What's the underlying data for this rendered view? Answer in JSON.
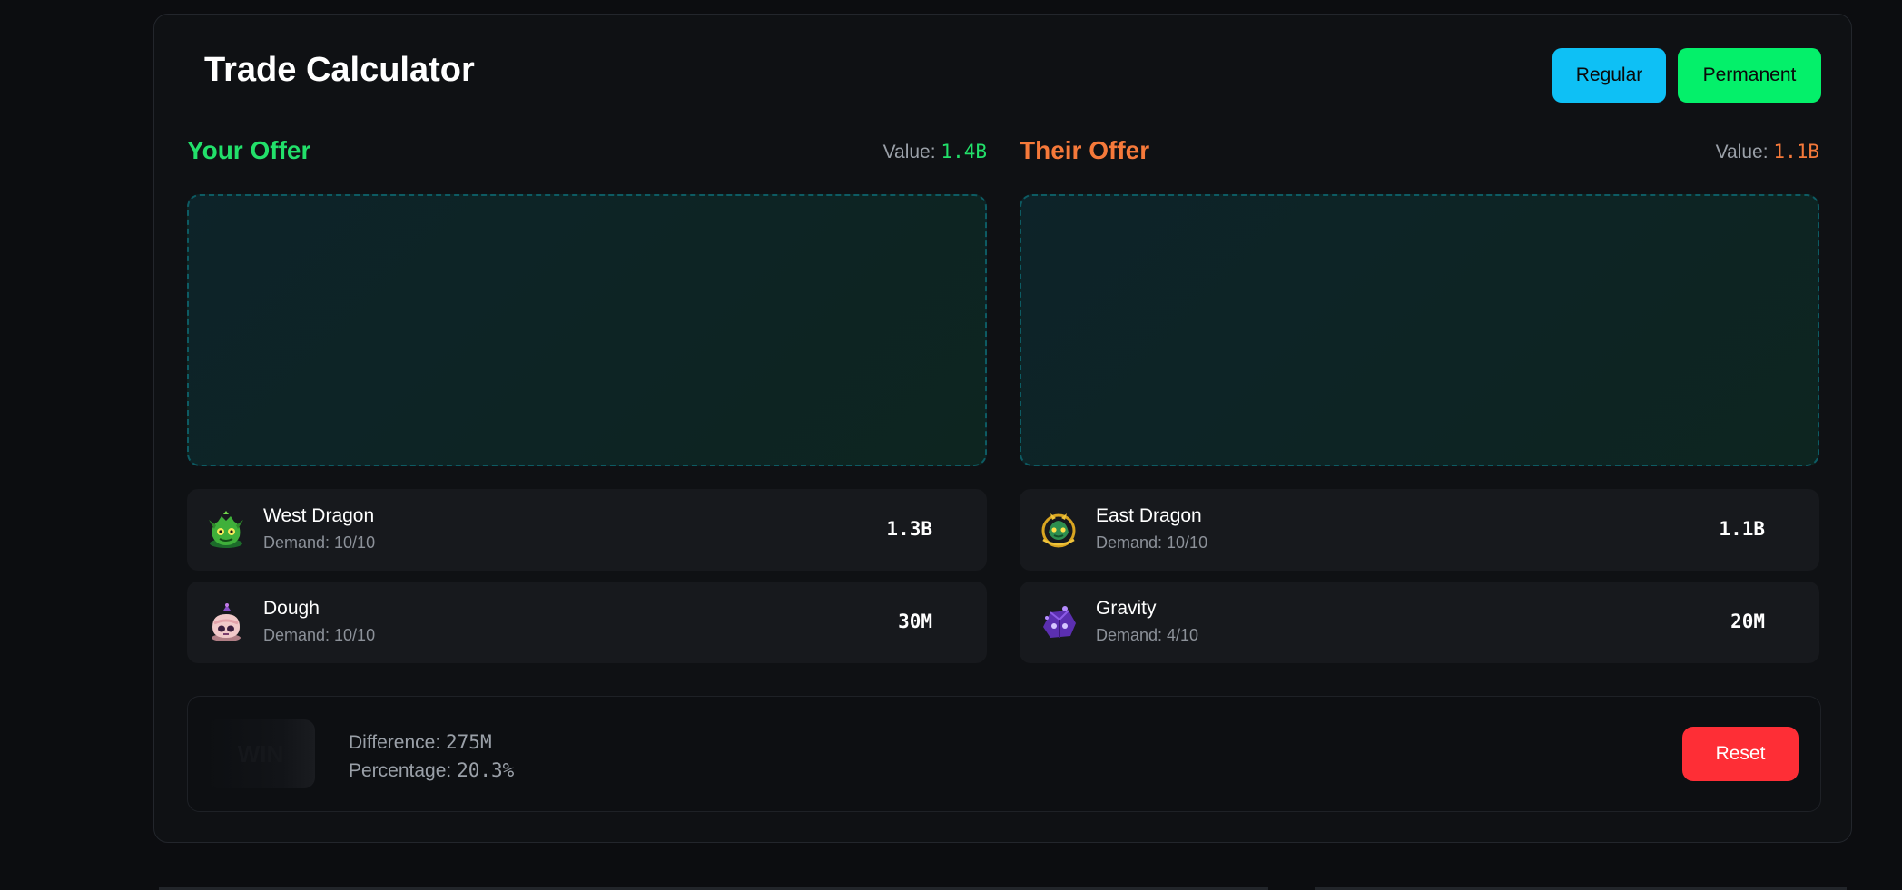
{
  "header": {
    "title": "Trade Calculator",
    "mode_buttons": [
      "Regular",
      "Permanent"
    ]
  },
  "your_offer": {
    "title": "Your Offer",
    "value_label": "Value:",
    "value": "1.4B",
    "items": [
      {
        "name": "West Dragon",
        "demand": "Demand: 10/10",
        "price": "1.3B",
        "icon": "west-dragon-icon"
      },
      {
        "name": "Dough",
        "demand": "Demand: 10/10",
        "price": "30M",
        "icon": "dough-icon"
      }
    ]
  },
  "their_offer": {
    "title": "Their Offer",
    "value_label": "Value:",
    "value": "1.1B",
    "items": [
      {
        "name": "East Dragon",
        "demand": "Demand: 10/10",
        "price": "1.1B",
        "icon": "east-dragon-icon"
      },
      {
        "name": "Gravity",
        "demand": "Demand: 4/10",
        "price": "20M",
        "icon": "gravity-icon"
      }
    ]
  },
  "result": {
    "verdict": "WIN",
    "difference_label": "Difference:",
    "difference": "275M",
    "percentage_label": "Percentage:",
    "percentage": "20.3%",
    "reset_label": "Reset"
  },
  "colors": {
    "your_offer": "#22e06a",
    "their_offer": "#f5793a",
    "regular_button": "#0ec0f5",
    "permanent_button": "#04f06a",
    "reset_button": "#fe2e36"
  }
}
